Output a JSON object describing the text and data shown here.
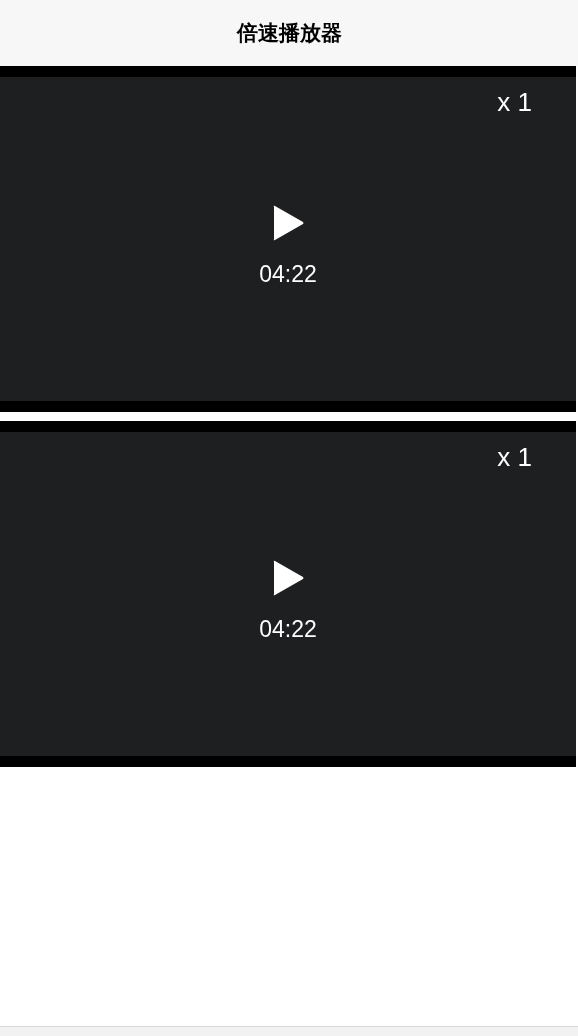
{
  "title": "倍速播放器",
  "videos": [
    {
      "speed": "x 1",
      "duration": "04:22"
    },
    {
      "speed": "x 1",
      "duration": "04:22"
    }
  ]
}
